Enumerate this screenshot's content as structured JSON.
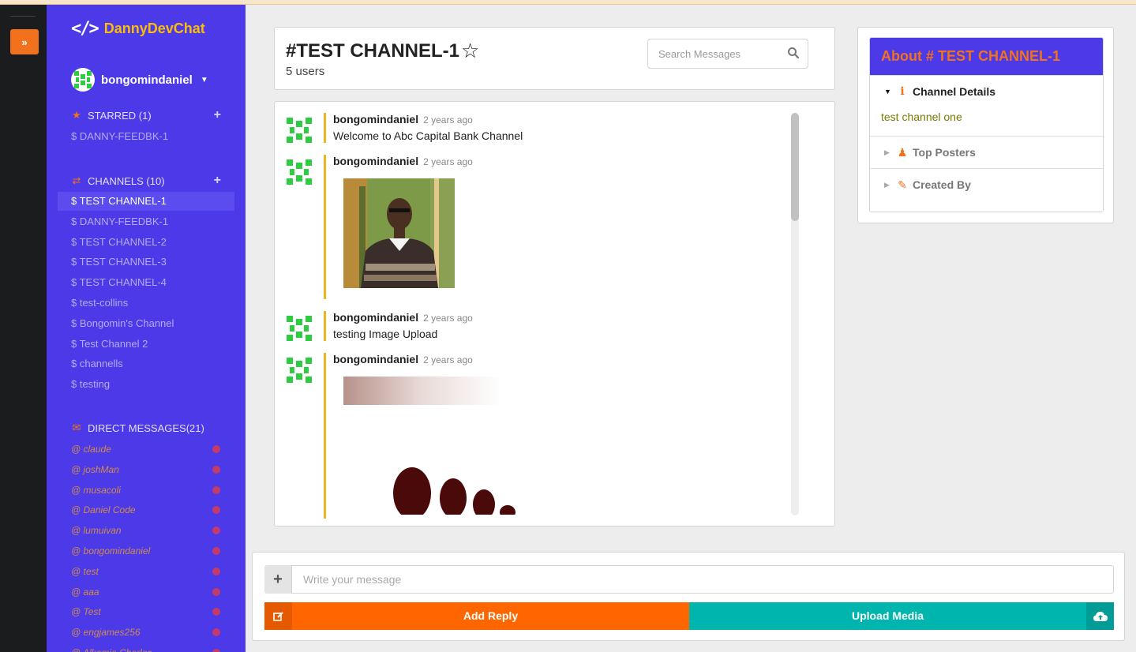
{
  "app": {
    "name": "DannyDevChat",
    "logo_glyph": "</>"
  },
  "user": {
    "name": "bongomindaniel"
  },
  "sidebar": {
    "starred": {
      "label": "STARRED (1)",
      "items": [
        "$ DANNY-FEEDBK-1"
      ]
    },
    "channels": {
      "label": "CHANNELS (10)",
      "items": [
        "$ TEST CHANNEL-1",
        "$ DANNY-FEEDBK-1",
        "$ TEST CHANNEL-2",
        "$ TEST CHANNEL-3",
        "$ TEST CHANNEL-4",
        "$ test-collins",
        "$ Bongomin's Channel",
        "$ Test Channel 2",
        "$ channells",
        "$ testing"
      ],
      "active_index": 0
    },
    "direct": {
      "label": "DIRECT MESSAGES(21)",
      "items": [
        "@ claude",
        "@ joshMan",
        "@ musacoli",
        "@ Daniel Code",
        "@ lumuivan",
        "@ bongomindaniel",
        "@ test",
        "@ aaa",
        "@ Test",
        "@ engjames256",
        "@ Alkamia Charles"
      ]
    }
  },
  "channel": {
    "title": "#TEST CHANNEL-1",
    "users": "5 users",
    "search_placeholder": "Search Messages"
  },
  "messages": [
    {
      "author": "bongomindaniel",
      "time": "2 years ago",
      "text": "Welcome to Abc Capital Bank Channel",
      "kind": "text"
    },
    {
      "author": "bongomindaniel",
      "time": "2 years ago",
      "text": "",
      "kind": "image"
    },
    {
      "author": "bongomindaniel",
      "time": "2 years ago",
      "text": "testing Image Upload",
      "kind": "text"
    },
    {
      "author": "bongomindaniel",
      "time": "2 years ago",
      "text": "",
      "kind": "image"
    }
  ],
  "about": {
    "title": "About # TEST CHANNEL-1",
    "details_label": "Channel Details",
    "details_text": "test channel one",
    "top_posters_label": "Top Posters",
    "created_by_label": "Created By"
  },
  "composer": {
    "placeholder": "Write your message",
    "reply_label": "Add Reply",
    "upload_label": "Upload Media"
  },
  "colors": {
    "sidebar": "#4c3ae8",
    "accent_orange": "#f2711c",
    "teal": "#00b5ad",
    "logo_text": "#fbbd08"
  }
}
